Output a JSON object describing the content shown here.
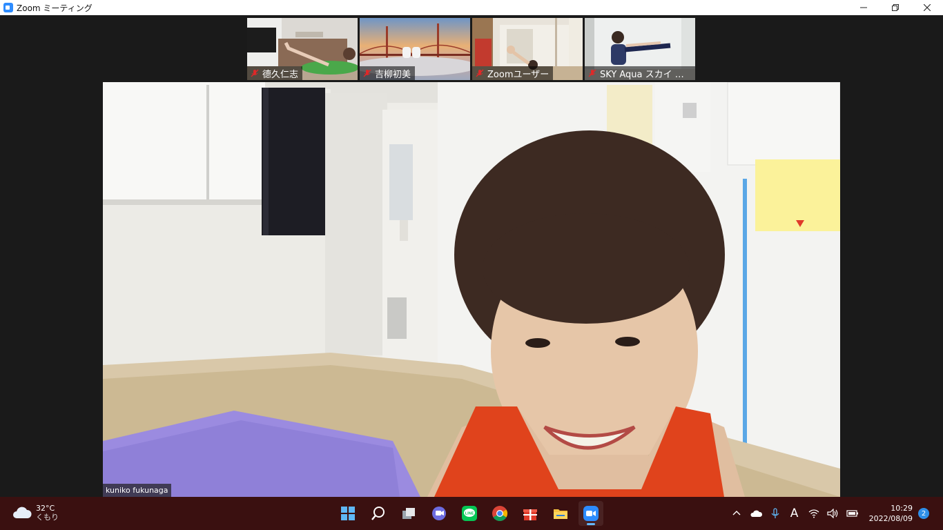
{
  "window": {
    "title": "Zoom ミーティング"
  },
  "thumbnails": [
    {
      "name": "德久仁志"
    },
    {
      "name": "吉柳初美"
    },
    {
      "name": "Zoomユーザー"
    },
    {
      "name": "SKY Aqua スカイ アク..."
    }
  ],
  "main": {
    "speaker_name": "kuniko fukunaga"
  },
  "taskbar": {
    "weather_temp": "32°C",
    "weather_condition": "くもり",
    "clock_time": "10:29",
    "clock_date": "2022/08/09",
    "notification_count": "2",
    "ime_label": "A"
  },
  "colors": {
    "zoom_blue": "#2d8cff",
    "mute_red": "#e02828",
    "taskbar_bg": "#3a1010",
    "shirt_orange": "#e0431c",
    "mat_purple": "#9b8be0"
  }
}
